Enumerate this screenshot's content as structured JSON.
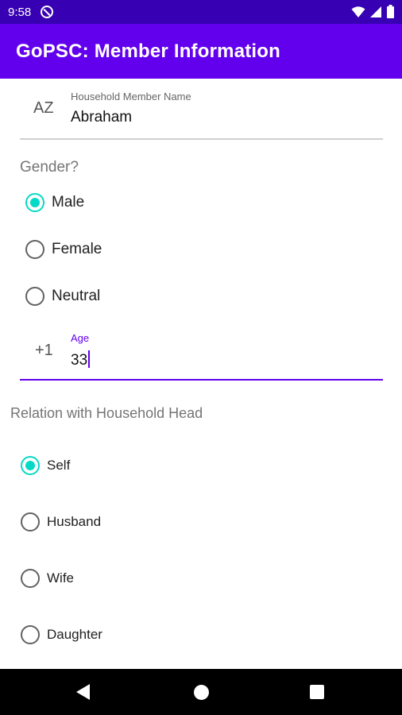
{
  "status_bar": {
    "time": "9:58",
    "icons": [
      "do-not-disturb-icon",
      "wifi-icon",
      "signal-icon",
      "battery-icon"
    ]
  },
  "app_bar": {
    "title": "GoPSC: Member Information"
  },
  "name_field": {
    "icon": "sort-alpha-icon",
    "icon_text": "AZ",
    "label": "Household Member Name",
    "value": "Abraham"
  },
  "gender": {
    "label": "Gender?",
    "options": [
      {
        "label": "Male",
        "checked": true
      },
      {
        "label": "Female",
        "checked": false
      },
      {
        "label": "Neutral",
        "checked": false
      }
    ]
  },
  "age_field": {
    "icon_text": "+1",
    "label": "Age",
    "value": "33"
  },
  "relation": {
    "label": "Relation with Household Head",
    "options": [
      {
        "label": "Self",
        "checked": true
      },
      {
        "label": "Husband",
        "checked": false
      },
      {
        "label": "Wife",
        "checked": false
      },
      {
        "label": "Daughter",
        "checked": false
      }
    ]
  },
  "colors": {
    "primary": "#6200ee",
    "primary_dark": "#3700b3",
    "accent": "#03dac5"
  }
}
